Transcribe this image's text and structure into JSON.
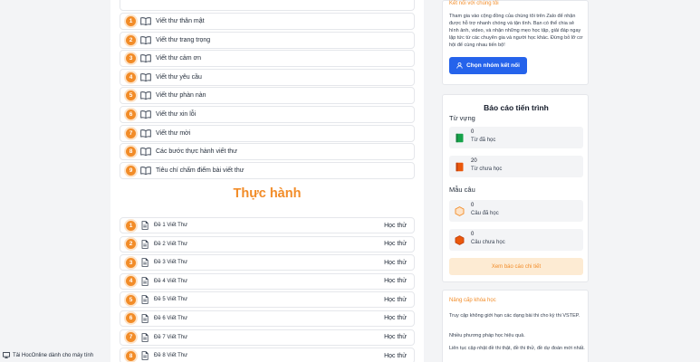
{
  "lessons": [
    {
      "num": "1",
      "label": "Viết thư thân mật"
    },
    {
      "num": "2",
      "label": "Viết thư trang trọng"
    },
    {
      "num": "3",
      "label": "Viết thư cảm ơn"
    },
    {
      "num": "4",
      "label": "Viết thư yêu cầu"
    },
    {
      "num": "5",
      "label": "Viết thư phàn nàn"
    },
    {
      "num": "6",
      "label": "Viết thư xin lỗi"
    },
    {
      "num": "7",
      "label": "Viết thư mời"
    },
    {
      "num": "8",
      "label": "Các bước thực hành viết thư"
    },
    {
      "num": "9",
      "label": "Tiêu chí chấm điểm bài viết thư"
    }
  ],
  "practice": {
    "title": "Thực hành",
    "try_label": "Học thử",
    "items": [
      {
        "num": "1",
        "label": "Đề 1 Viết Thư"
      },
      {
        "num": "2",
        "label": "Đề 2 Viết Thư"
      },
      {
        "num": "3",
        "label": "Đề 3 Viết Thư"
      },
      {
        "num": "4",
        "label": "Đề 4 Viết Thư"
      },
      {
        "num": "5",
        "label": "Đề 5 Viết Thư"
      },
      {
        "num": "6",
        "label": "Đề 6 Viết Thư"
      },
      {
        "num": "7",
        "label": "Đề 7 Viết Thư"
      },
      {
        "num": "8",
        "label": "Đề 8 Viết Thư"
      }
    ]
  },
  "join": {
    "title": "Kết nối với chúng tôi",
    "text": "Tham gia vào cộng đồng của chúng tôi trên Zalo để nhận được hỗ trợ nhanh chóng và tận tình. Bạn có thể chia sẻ hình ảnh, video, và nhận những mẹo học tập, giải đáp ngay lập tức từ các chuyên gia và người học khác. Đừng bỏ lỡ cơ hội để cùng nhau tiến bộ!",
    "button": "Chọn nhóm kết nối"
  },
  "progress": {
    "title": "Báo cáo tiến trình",
    "vocab_label": "Từ vựng",
    "vocab_learned_value": "0",
    "vocab_learned_label": "Từ đã học",
    "vocab_unlearned_value": "20",
    "vocab_unlearned_label": "Từ chưa học",
    "sentence_label": "Mẫu câu",
    "sentence_learned_value": "0",
    "sentence_learned_label": "Câu đã học",
    "sentence_unlearned_value": "0",
    "sentence_unlearned_label": "Câu chưa học",
    "detail_button": "Xem báo cáo chi tiết"
  },
  "upgrade": {
    "title": "Nâng cấp khóa học",
    "p1": "Truy cập không giới hạn các dạng bài thi cho kỳ thi VSTEP.",
    "p2": "Nhiều phương pháp học hiệu quả.",
    "p3": "Liên tục cập nhật đề thi thật, đề thi thử, đề dự đoán mới nhất."
  },
  "footer": {
    "download_label": "Tải HocOnline dành cho máy tính"
  },
  "colors": {
    "accent": "#f28c28",
    "primary": "#2563eb"
  }
}
